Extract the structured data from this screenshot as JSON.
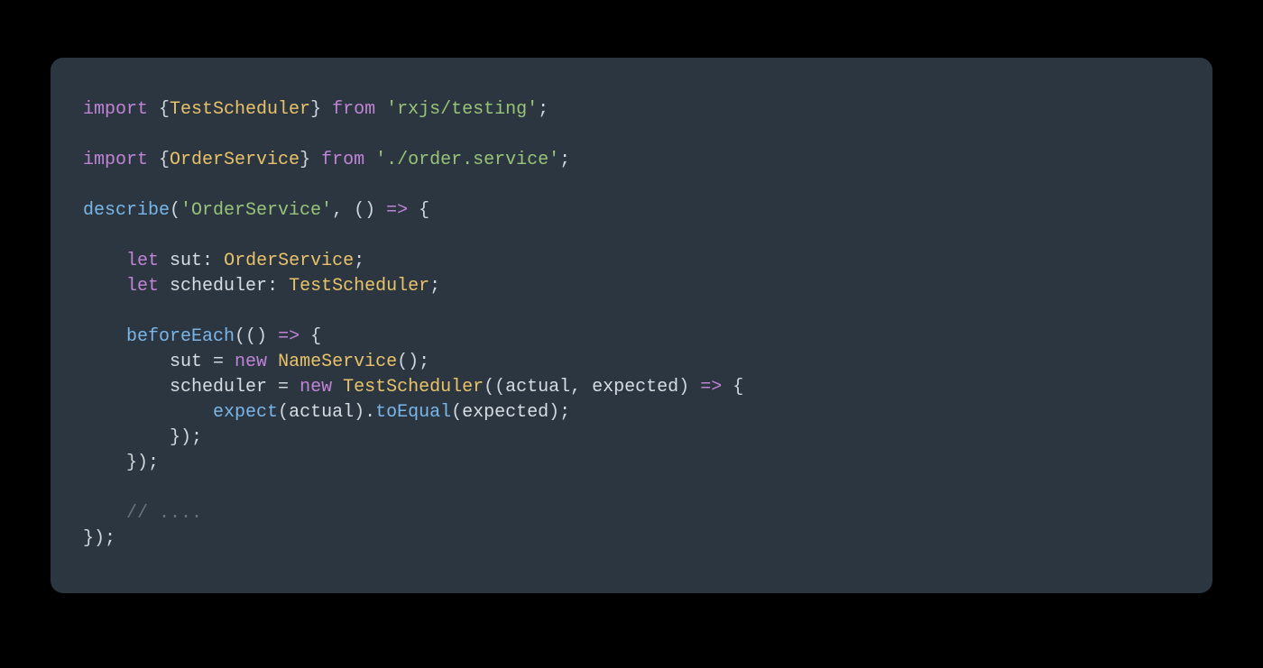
{
  "colors": {
    "background": "#000000",
    "card": "#2c3640",
    "text": "#d7dde3",
    "keyword": "#c084d6",
    "function": "#7ab6e8",
    "type": "#e9c36a",
    "string": "#98c379",
    "comment": "#6a737d"
  },
  "code": {
    "language": "typescript",
    "lines": [
      [
        {
          "t": "import ",
          "c": "key"
        },
        {
          "t": "{",
          "c": "punc"
        },
        {
          "t": "TestScheduler",
          "c": "type"
        },
        {
          "t": "}",
          "c": "punc"
        },
        {
          "t": " from ",
          "c": "key"
        },
        {
          "t": "'rxjs/testing'",
          "c": "str"
        },
        {
          "t": ";",
          "c": "punc"
        }
      ],
      [],
      [
        {
          "t": "import ",
          "c": "key"
        },
        {
          "t": "{",
          "c": "punc"
        },
        {
          "t": "OrderService",
          "c": "type"
        },
        {
          "t": "}",
          "c": "punc"
        },
        {
          "t": " from ",
          "c": "key"
        },
        {
          "t": "'./order.service'",
          "c": "str"
        },
        {
          "t": ";",
          "c": "punc"
        }
      ],
      [],
      [
        {
          "t": "describe",
          "c": "fn"
        },
        {
          "t": "(",
          "c": "punc"
        },
        {
          "t": "'OrderService'",
          "c": "str"
        },
        {
          "t": ", () ",
          "c": "punc"
        },
        {
          "t": "=>",
          "c": "arrow"
        },
        {
          "t": " {",
          "c": "punc"
        }
      ],
      [],
      [
        {
          "t": "    ",
          "c": "punc"
        },
        {
          "t": "let ",
          "c": "key"
        },
        {
          "t": "sut",
          "c": "var"
        },
        {
          "t": ": ",
          "c": "punc"
        },
        {
          "t": "OrderService",
          "c": "type"
        },
        {
          "t": ";",
          "c": "punc"
        }
      ],
      [
        {
          "t": "    ",
          "c": "punc"
        },
        {
          "t": "let ",
          "c": "key"
        },
        {
          "t": "scheduler",
          "c": "var"
        },
        {
          "t": ": ",
          "c": "punc"
        },
        {
          "t": "TestScheduler",
          "c": "type"
        },
        {
          "t": ";",
          "c": "punc"
        }
      ],
      [],
      [
        {
          "t": "    ",
          "c": "punc"
        },
        {
          "t": "beforeEach",
          "c": "fn"
        },
        {
          "t": "(() ",
          "c": "punc"
        },
        {
          "t": "=>",
          "c": "arrow"
        },
        {
          "t": " {",
          "c": "punc"
        }
      ],
      [
        {
          "t": "        ",
          "c": "punc"
        },
        {
          "t": "sut",
          "c": "var"
        },
        {
          "t": " = ",
          "c": "punc"
        },
        {
          "t": "new ",
          "c": "key"
        },
        {
          "t": "NameService",
          "c": "type"
        },
        {
          "t": "();",
          "c": "punc"
        }
      ],
      [
        {
          "t": "        ",
          "c": "punc"
        },
        {
          "t": "scheduler",
          "c": "var"
        },
        {
          "t": " = ",
          "c": "punc"
        },
        {
          "t": "new ",
          "c": "key"
        },
        {
          "t": "TestScheduler",
          "c": "type"
        },
        {
          "t": "((",
          "c": "punc"
        },
        {
          "t": "actual",
          "c": "var"
        },
        {
          "t": ", ",
          "c": "punc"
        },
        {
          "t": "expected",
          "c": "var"
        },
        {
          "t": ") ",
          "c": "punc"
        },
        {
          "t": "=>",
          "c": "arrow"
        },
        {
          "t": " {",
          "c": "punc"
        }
      ],
      [
        {
          "t": "            ",
          "c": "punc"
        },
        {
          "t": "expect",
          "c": "fn"
        },
        {
          "t": "(",
          "c": "punc"
        },
        {
          "t": "actual",
          "c": "var"
        },
        {
          "t": ").",
          "c": "punc"
        },
        {
          "t": "toEqual",
          "c": "meth"
        },
        {
          "t": "(",
          "c": "punc"
        },
        {
          "t": "expected",
          "c": "var"
        },
        {
          "t": ");",
          "c": "punc"
        }
      ],
      [
        {
          "t": "        });",
          "c": "punc"
        }
      ],
      [
        {
          "t": "    });",
          "c": "punc"
        }
      ],
      [],
      [
        {
          "t": "    ",
          "c": "punc"
        },
        {
          "t": "// ....",
          "c": "cmt"
        }
      ],
      [
        {
          "t": "});",
          "c": "punc"
        }
      ]
    ]
  }
}
